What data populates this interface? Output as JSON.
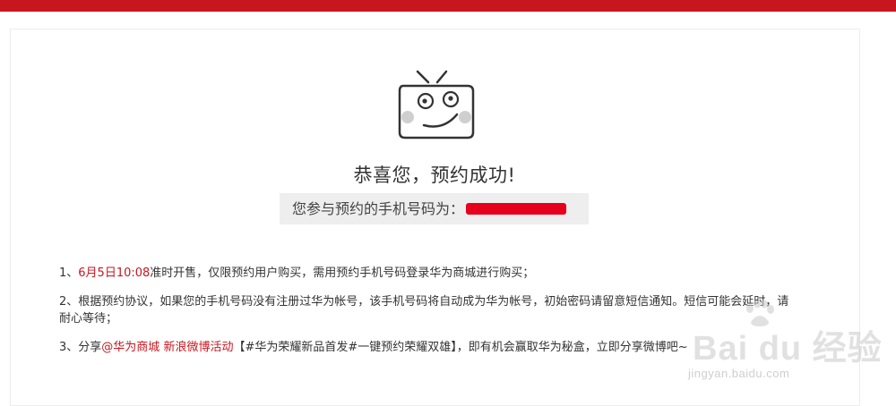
{
  "header": {
    "bar_color": "#c8161e"
  },
  "success": {
    "title": "恭喜您，预约成功!",
    "phone_label": "您参与预约的手机号码为：",
    "phone_value_redacted": true
  },
  "notes": {
    "n1_prefix": "1、",
    "n1_highlight": "6月5日10:08",
    "n1_text": "准时开售，仅限预约用户购买，需用预约手机号码登录华为商城进行购买；",
    "n2_line1": "2、根据预约协议，如果您的手机号码没有注册过华为帐号，该手机号码将自动成为华为帐号，初始密码请留意短信通知。短信可能会延时，请",
    "n2_line2": "耐心等待；",
    "n3_prefix": "3、分享",
    "n3_link1": "@华为商城",
    "n3_link2": "新浪微博活动",
    "n3_text": "【#华为荣耀新品首发#一键预约荣耀双雄】，即有机会赢取华为秘盒，立即分享微博吧~"
  },
  "watermark": {
    "logo_text": "Bai du 经验",
    "url": "jingyan.baidu.com"
  },
  "colors": {
    "accent": "#c8161e",
    "mask": "#e6001c",
    "panel_bg": "#eeeeee"
  }
}
